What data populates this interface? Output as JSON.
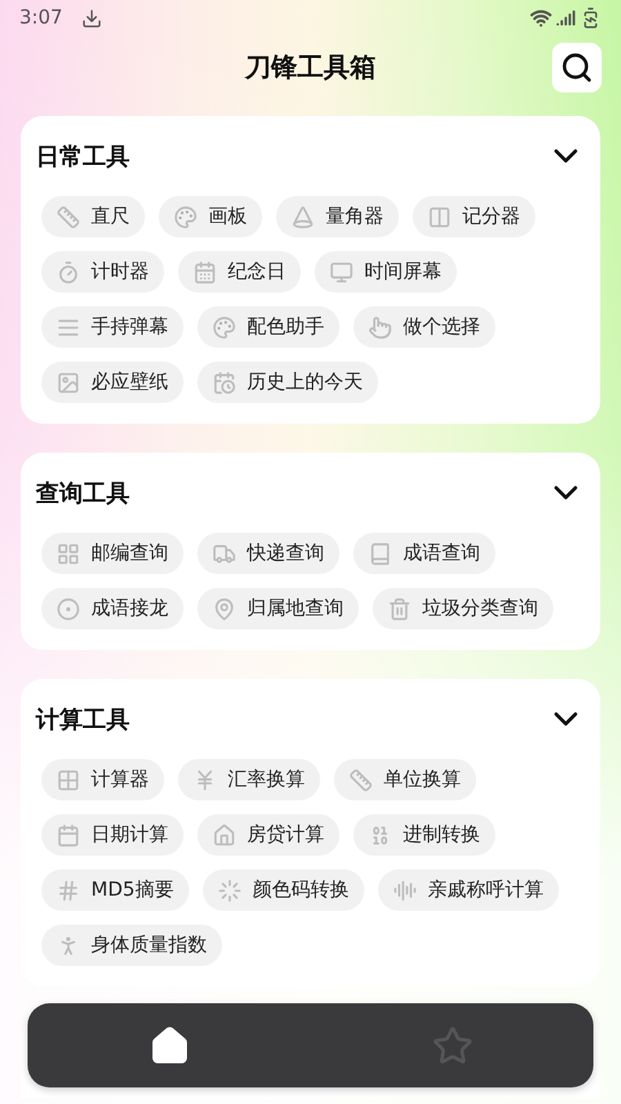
{
  "status_bar": {
    "time": "3:07"
  },
  "header": {
    "title": "刀锋工具箱"
  },
  "sections": [
    {
      "title": "日常工具",
      "expanded": true,
      "tools": [
        "直尺",
        "画板",
        "量角器",
        "记分器",
        "计时器",
        "纪念日",
        "时间屏幕",
        "手持弹幕",
        "配色助手",
        "做个选择",
        "必应壁纸",
        "历史上的今天"
      ]
    },
    {
      "title": "查询工具",
      "expanded": true,
      "tools": [
        "邮编查询",
        "快递查询",
        "成语查询",
        "成语接龙",
        "归属地查询",
        "垃圾分类查询"
      ]
    },
    {
      "title": "计算工具",
      "expanded": true,
      "tools": [
        "计算器",
        "汇率换算",
        "单位换算",
        "日期计算",
        "房贷计算",
        "进制转换",
        "MD5摘要",
        "颜色码转换",
        "亲戚称呼计算",
        "身体质量指数"
      ]
    }
  ],
  "bottom_nav": [
    {
      "kind": "home",
      "selected": true
    },
    {
      "kind": "favorites",
      "selected": false
    }
  ]
}
